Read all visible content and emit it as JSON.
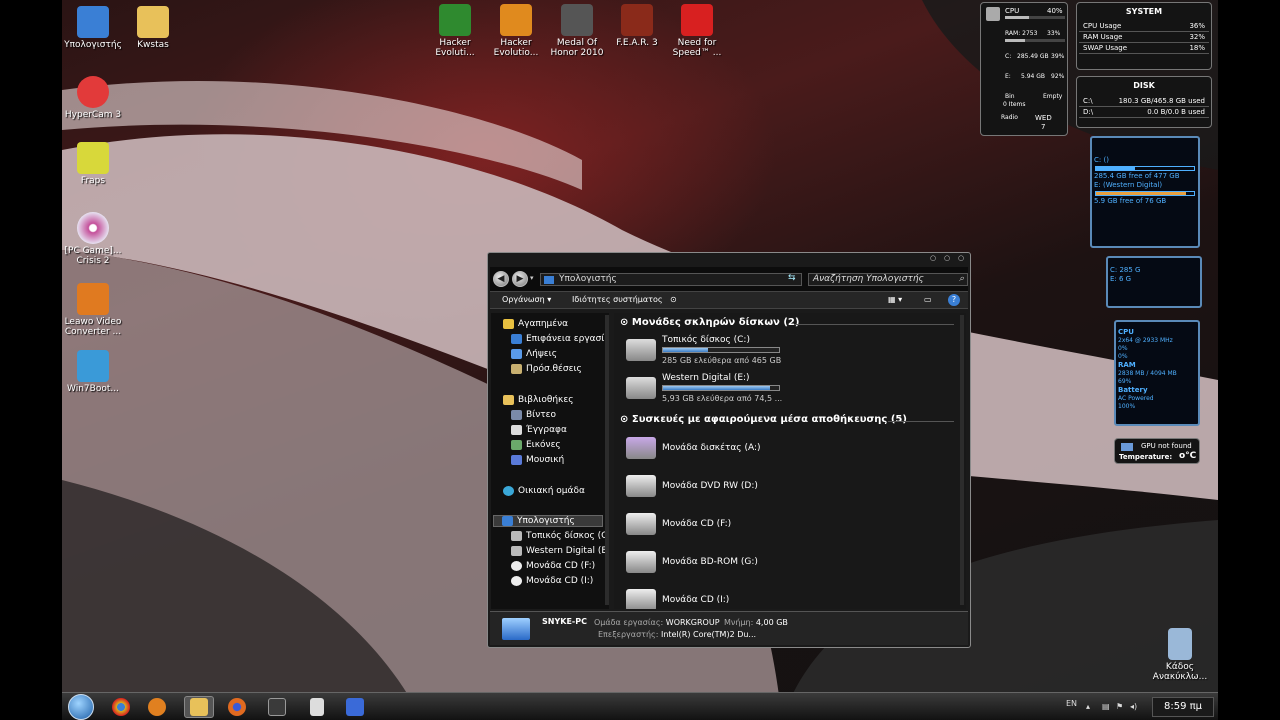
{
  "desktop": {
    "icons": [
      {
        "label": "Υπολογιστής",
        "icon": "computer-icon",
        "color": "#3a7fd5"
      },
      {
        "label": "Kwstas",
        "icon": "folder-icon",
        "color": "#e8c15a"
      },
      {
        "label": "Hacker Evoluti...",
        "icon": "hacker-evolution-icon",
        "color": "#2f8a2f"
      },
      {
        "label": "Hacker Evolutio...",
        "icon": "hacker-evolution-2-icon",
        "color": "#e08a1e"
      },
      {
        "label": "Medal Of Honor 2010",
        "icon": "medal-of-honor-icon",
        "color": "#555555"
      },
      {
        "label": "F.E.A.R. 3",
        "icon": "fear3-icon",
        "color": "#8a2a1a"
      },
      {
        "label": "Need for Speed™ ...",
        "icon": "need-for-speed-icon",
        "color": "#d82020"
      },
      {
        "label": "HyperCam 3",
        "icon": "hypercam-icon",
        "color": "#e23a3a"
      },
      {
        "label": "Fraps",
        "icon": "fraps-icon",
        "color": "#d8d83a"
      },
      {
        "label": "[PC Game]... Crisis 2",
        "icon": "disc-icon",
        "color": "#c44f9a"
      },
      {
        "label": "Leawo Video Converter ...",
        "icon": "leawo-icon",
        "color": "#e07a20"
      },
      {
        "label": "Win7Boot...",
        "icon": "win7boot-icon",
        "color": "#3a9ad8"
      },
      {
        "label": "Κάδος Ανακύκλω...",
        "icon": "recycle-bin-icon",
        "color": "#9ab8d8"
      }
    ]
  },
  "gadgets": {
    "monitor": {
      "cpu_label": "CPU",
      "cpu_pct": "40%",
      "cpu_value": 0.4,
      "ram_label": "RAM: 2753",
      "ram_pct": "33%",
      "ram_value": 0.33,
      "c_label": "C:",
      "c_text": "285.49 GB",
      "c_pct": "39%",
      "e_label": "E:",
      "e_text": "5.94 GB",
      "e_pct": "92%",
      "bin_label": "Bin",
      "bin_state": "Empty",
      "bin_items": "0 Items",
      "radio_label": "Radio",
      "day": "WED",
      "date": "7"
    },
    "system": {
      "title": "SYSTEM",
      "rows": [
        {
          "label": "CPU Usage",
          "value": "36%"
        },
        {
          "label": "RAM Usage",
          "value": "32%"
        },
        {
          "label": "SWAP Usage",
          "value": "18%"
        }
      ]
    },
    "disk": {
      "title": "DISK",
      "rows": [
        {
          "label": "C:\\",
          "value": "180.3 GB/465.8 GB used"
        },
        {
          "label": "D:\\",
          "value": "0.0 B/0.0 B used"
        }
      ]
    },
    "drive_blue": {
      "c_label": "C: ()",
      "c_free": "285.4 GB free of 477 GB",
      "c_value": 0.4,
      "e_label": "E: (Western Digital)",
      "e_free": "5.9 GB free of 76 GB",
      "e_value": 0.92
    },
    "drive_small": {
      "c": "C: 285 G",
      "e": "E: 6 G"
    },
    "sysmeter": {
      "cpu_title": "CPU",
      "cpu_info": "2x64 @ 2933 MHz",
      "cpu_p1": "0%",
      "cpu_p2": "0%",
      "ram_title": "RAM",
      "ram_info": "2838 MB / 4094 MB",
      "ram_pct": "69%",
      "battery_title": "Battery",
      "battery_info": "AC Powered",
      "battery_pct": "100%"
    },
    "gpu": {
      "status": "GPU not found",
      "temp_label": "Temperature:",
      "temp_value": "o°C"
    }
  },
  "explorer": {
    "address": "Υπολογιστής",
    "search_placeholder": "Αναζήτηση Υπολογιστής",
    "toolbar": {
      "organize": "Οργάνωση",
      "properties": "Ιδιότητες συστήματος"
    },
    "nav": {
      "favorites": "Αγαπημένα",
      "desktop": "Επιφάνεια εργασί",
      "downloads": "Λήψεις",
      "recent": "Πρόσ.θέσεις",
      "libraries": "Βιβλιοθήκες",
      "videos": "Βίντεο",
      "documents": "Έγγραφα",
      "pictures": "Εικόνες",
      "music": "Μουσική",
      "homegroup": "Οικιακή ομάδα",
      "computer": "Υπολογιστής",
      "local_disk": "Τοπικός δίσκος (C",
      "western": "Western Digital (E",
      "cd_f": "Μονάδα CD (F:)",
      "cd_i": "Μονάδα CD (I:)"
    },
    "hdd_group": "Μονάδες σκληρών δίσκων (2)",
    "drives": [
      {
        "name": "Τοπικός δίσκος (C:)",
        "free": "285 GB ελεύθερα από 465 GB",
        "used": 0.39
      },
      {
        "name": "Western Digital (E:)",
        "free": "5,93 GB ελεύθερα από 74,5 ...",
        "used": 0.92
      }
    ],
    "removable_group": "Συσκευές με αφαιρούμενα μέσα αποθήκευσης (5)",
    "removable": [
      {
        "name": "Μονάδα δισκέτας (A:)",
        "icon": "floppy-drive-icon"
      },
      {
        "name": "Μονάδα DVD RW (D:)",
        "icon": "dvd-drive-icon"
      },
      {
        "name": "Μονάδα CD (F:)",
        "icon": "cd-drive-icon"
      },
      {
        "name": "Μονάδα BD-ROM (G:)",
        "icon": "bd-drive-icon"
      },
      {
        "name": "Μονάδα CD (I:)",
        "icon": "cd-drive-icon"
      }
    ],
    "details": {
      "pc_name": "SNYKE-PC",
      "workgroup_label": "Ομάδα εργασίας:",
      "workgroup": "WORKGROUP",
      "memory_label": "Μνήμη:",
      "memory": "4,00 GB",
      "cpu_label": "Επεξεργαστής:",
      "cpu": "Intel(R) Core(TM)2 Du..."
    }
  },
  "taskbar": {
    "apps": [
      {
        "icon": "chrome-icon",
        "color": "#d8b020"
      },
      {
        "icon": "media-player-icon",
        "color": "#e08020"
      },
      {
        "icon": "explorer-icon",
        "color": "#e8c15a"
      },
      {
        "icon": "firefox-icon",
        "color": "#e06a20"
      },
      {
        "icon": "nfs-icon",
        "color": "#3a3a3a"
      },
      {
        "icon": "document-icon",
        "color": "#dddddd"
      },
      {
        "icon": "cs-icon",
        "color": "#3a6ad8"
      }
    ],
    "lang": "EN",
    "time": "8:59 πμ"
  }
}
